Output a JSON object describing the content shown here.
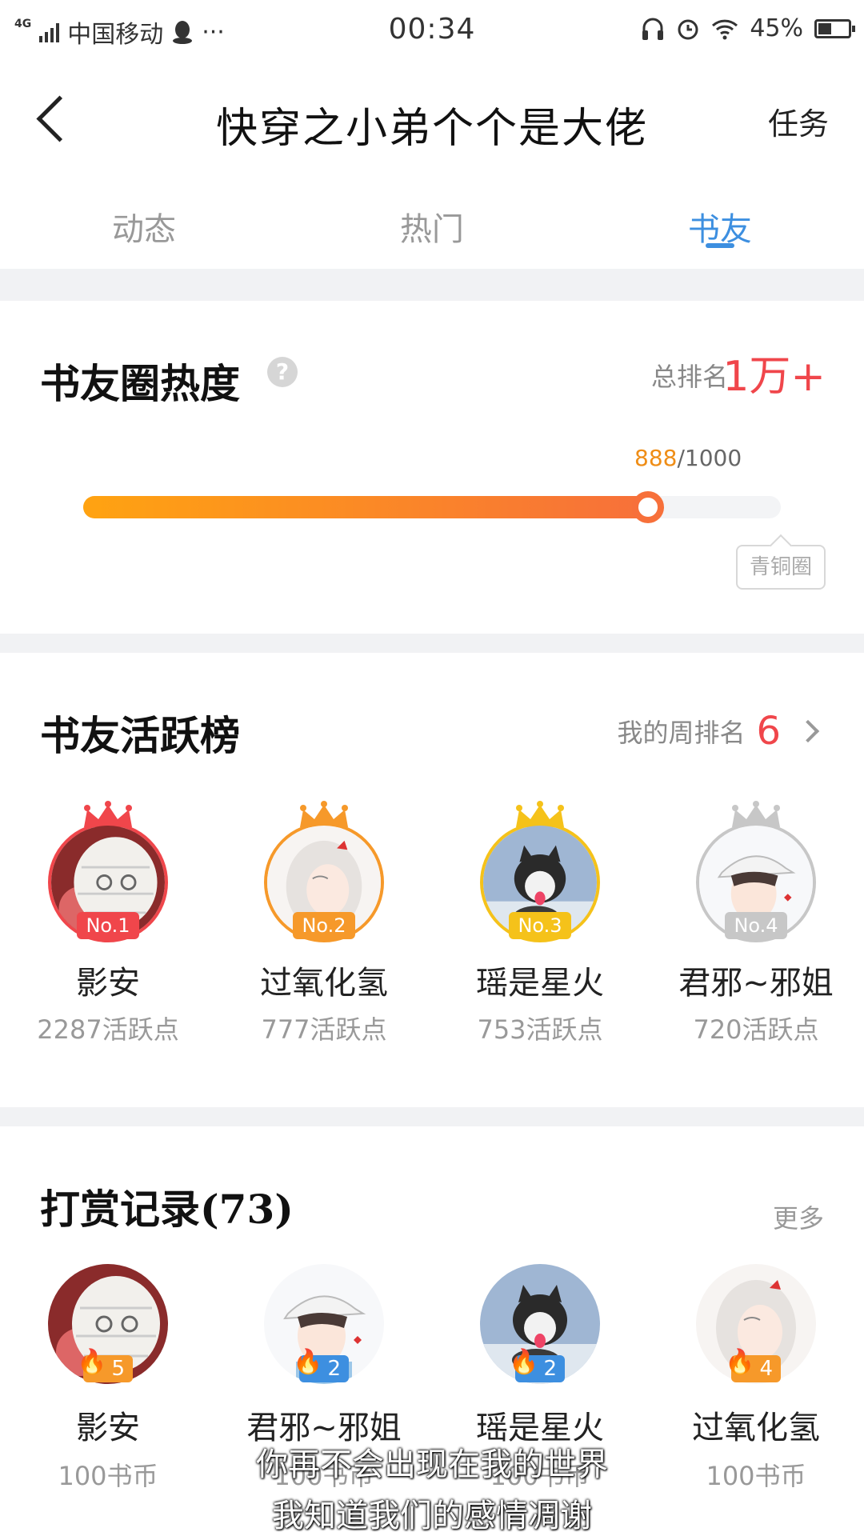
{
  "status_bar": {
    "network": "4G",
    "carrier": "中国移动",
    "more": "···",
    "time": "00:34",
    "battery": "45%",
    "battery_level": 0.45
  },
  "header": {
    "title": "快穿之小弟个个是大佬",
    "task_label": "任务"
  },
  "tabs": [
    {
      "label": "动态",
      "active": false
    },
    {
      "label": "热门",
      "active": false
    },
    {
      "label": "书友",
      "active": true
    }
  ],
  "heat": {
    "title": "书友圈热度",
    "help": "?",
    "rank_label": "总排名",
    "rank_value": "1万+",
    "progress_current": "888",
    "progress_total": "/1000",
    "progress_fraction": 0.888,
    "level_tag": "青铜圈"
  },
  "active": {
    "title": "书友活跃榜",
    "week_rank_label": "我的周排名",
    "week_rank_value": "6",
    "items": [
      {
        "badge": "No.1",
        "name": "影安",
        "points": "2287活跃点",
        "color": "#f0464b",
        "avatar": "mummy"
      },
      {
        "badge": "No.2",
        "name": "过氧化氢",
        "points": "777活跃点",
        "color": "#f6992a",
        "avatar": "white-hair"
      },
      {
        "badge": "No.3",
        "name": "瑶是星火",
        "points": "753活跃点",
        "color": "#f5c21a",
        "avatar": "husky"
      },
      {
        "badge": "No.4",
        "name": "君邪~邪姐",
        "points": "720活跃点",
        "color": "#c7c7c7",
        "avatar": "cap-boy"
      }
    ]
  },
  "rewards": {
    "title": "打赏记录(73)",
    "more_label": "更多",
    "items": [
      {
        "count": "5",
        "name": "影安",
        "coins": "100书币",
        "badge_color": "#f6992a",
        "avatar": "mummy"
      },
      {
        "count": "2",
        "name": "君邪~邪姐",
        "coins": "100书币",
        "badge_color": "#3d8fe0",
        "avatar": "cap-boy"
      },
      {
        "count": "2",
        "name": "瑶是星火",
        "coins": "100书币",
        "badge_color": "#3d8fe0",
        "avatar": "husky"
      },
      {
        "count": "4",
        "name": "过氧化氢",
        "coins": "100书币",
        "badge_color": "#f6992a",
        "avatar": "white-hair"
      }
    ]
  },
  "subtitles": {
    "line1": "你再不会出现在我的世界",
    "line2": "我知道我们的感情凋谢"
  }
}
